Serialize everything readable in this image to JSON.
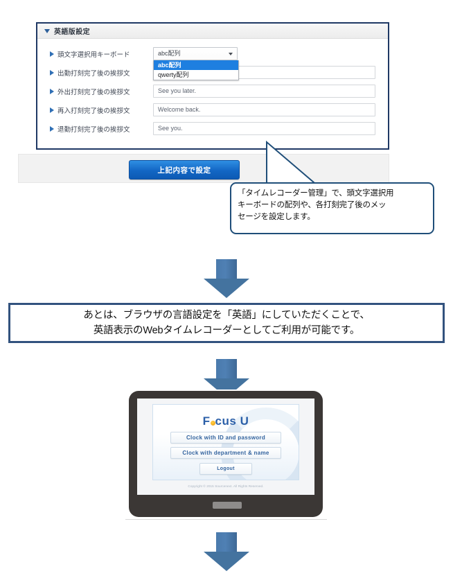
{
  "settings_panel": {
    "header_title": "英語版設定",
    "rows": [
      {
        "label": "頭文字選択用キーボード",
        "type": "select",
        "value": "abc配列",
        "options": [
          "abc配列",
          "qwerty配列"
        ],
        "selected_option": "abc配列"
      },
      {
        "label": "出勤打刻完了後の挨拶文",
        "type": "text",
        "value": ""
      },
      {
        "label": "外出打刻完了後の挨拶文",
        "type": "text",
        "value": "See you later."
      },
      {
        "label": "再入打刻完了後の挨拶文",
        "type": "text",
        "value": "Welcome back."
      },
      {
        "label": "退勤打刻完了後の挨拶文",
        "type": "text",
        "value": "See you."
      }
    ],
    "submit_label": "上記内容で設定"
  },
  "callout": {
    "lines": [
      "「タイムレコーダー管理」で、頭文字選択用",
      "キーボードの配列や、各打刻完了後のメッ",
      "セージを設定します。"
    ]
  },
  "note_box": {
    "lines": [
      "あとは、ブラウザの言語設定を「英語」にしていただくことで、",
      "英語表示のWebタイムレコーダーとしてご利用が可能です。"
    ]
  },
  "tablet": {
    "screen": {
      "logo_pre": "F",
      "logo_post": "cus U",
      "buttons": [
        "Clock with ID and password",
        "Clock with department & name",
        "Logout"
      ],
      "copyright": "Copyright © 2015 Sourcenext. All Rights Reserved."
    }
  },
  "colors": {
    "panel_border": "#1f3864",
    "accent_blue": "#1266c4",
    "arrow_blue": "#44739f",
    "note_border": "#32527e",
    "callout_border": "#1f4e79",
    "select_highlight": "#1e7fe0",
    "tablet_frame": "#3b3735",
    "logo_blue": "#2b5fa8",
    "logo_dot": "#f3a417"
  }
}
